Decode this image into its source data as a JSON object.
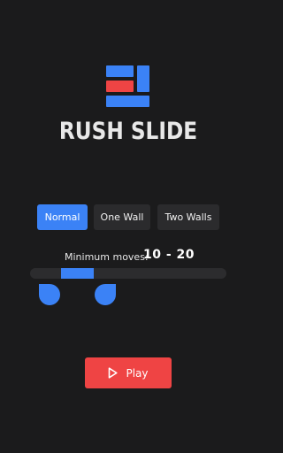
{
  "app": {
    "title": "RUSH SLIDE"
  },
  "logo": {
    "icon": "rush-slide-logo",
    "colors": {
      "primary": "#3b82f6",
      "accent": "#ef4444"
    }
  },
  "modes": {
    "items": [
      {
        "label": "Normal",
        "selected": true
      },
      {
        "label": "One Wall",
        "selected": false
      },
      {
        "label": "Two Walls",
        "selected": false
      }
    ]
  },
  "moves": {
    "label": "Minimum moves:",
    "value": "10 - 20",
    "range_min": 10,
    "range_max": 20
  },
  "play": {
    "label": "Play",
    "icon": "play-icon",
    "color": "#ef4444"
  },
  "colors": {
    "background": "#1b1b1c",
    "button": "#2b2b2d",
    "accent_blue": "#3b82f6",
    "accent_red": "#ef4444"
  }
}
